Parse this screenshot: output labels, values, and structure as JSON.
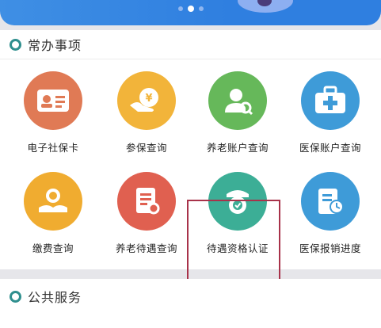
{
  "banner": {
    "active_dot": 2,
    "dot_count": 3
  },
  "section_common": {
    "title": "常办事项"
  },
  "section_public": {
    "title": "公共服务"
  },
  "services": [
    {
      "label": "电子社保卡",
      "icon": "id-card-icon",
      "color": "#e07a55"
    },
    {
      "label": "参保查询",
      "icon": "money-hand-icon",
      "color": "#f2b43a"
    },
    {
      "label": "养老账户查询",
      "icon": "user-search-icon",
      "color": "#66b85a"
    },
    {
      "label": "医保账户查询",
      "icon": "medical-kit-icon",
      "color": "#3e9bd8"
    },
    {
      "label": "缴费查询",
      "icon": "coin-hand-icon",
      "color": "#f0ac30"
    },
    {
      "label": "养老待遇查询",
      "icon": "document-search-icon",
      "color": "#e06050"
    },
    {
      "label": "待遇资格认证",
      "icon": "camera-verify-icon",
      "color": "#3cae96"
    },
    {
      "label": "医保报销进度",
      "icon": "progress-doc-icon",
      "color": "#3e9bd8"
    }
  ],
  "highlighted_service": "待遇资格认证"
}
